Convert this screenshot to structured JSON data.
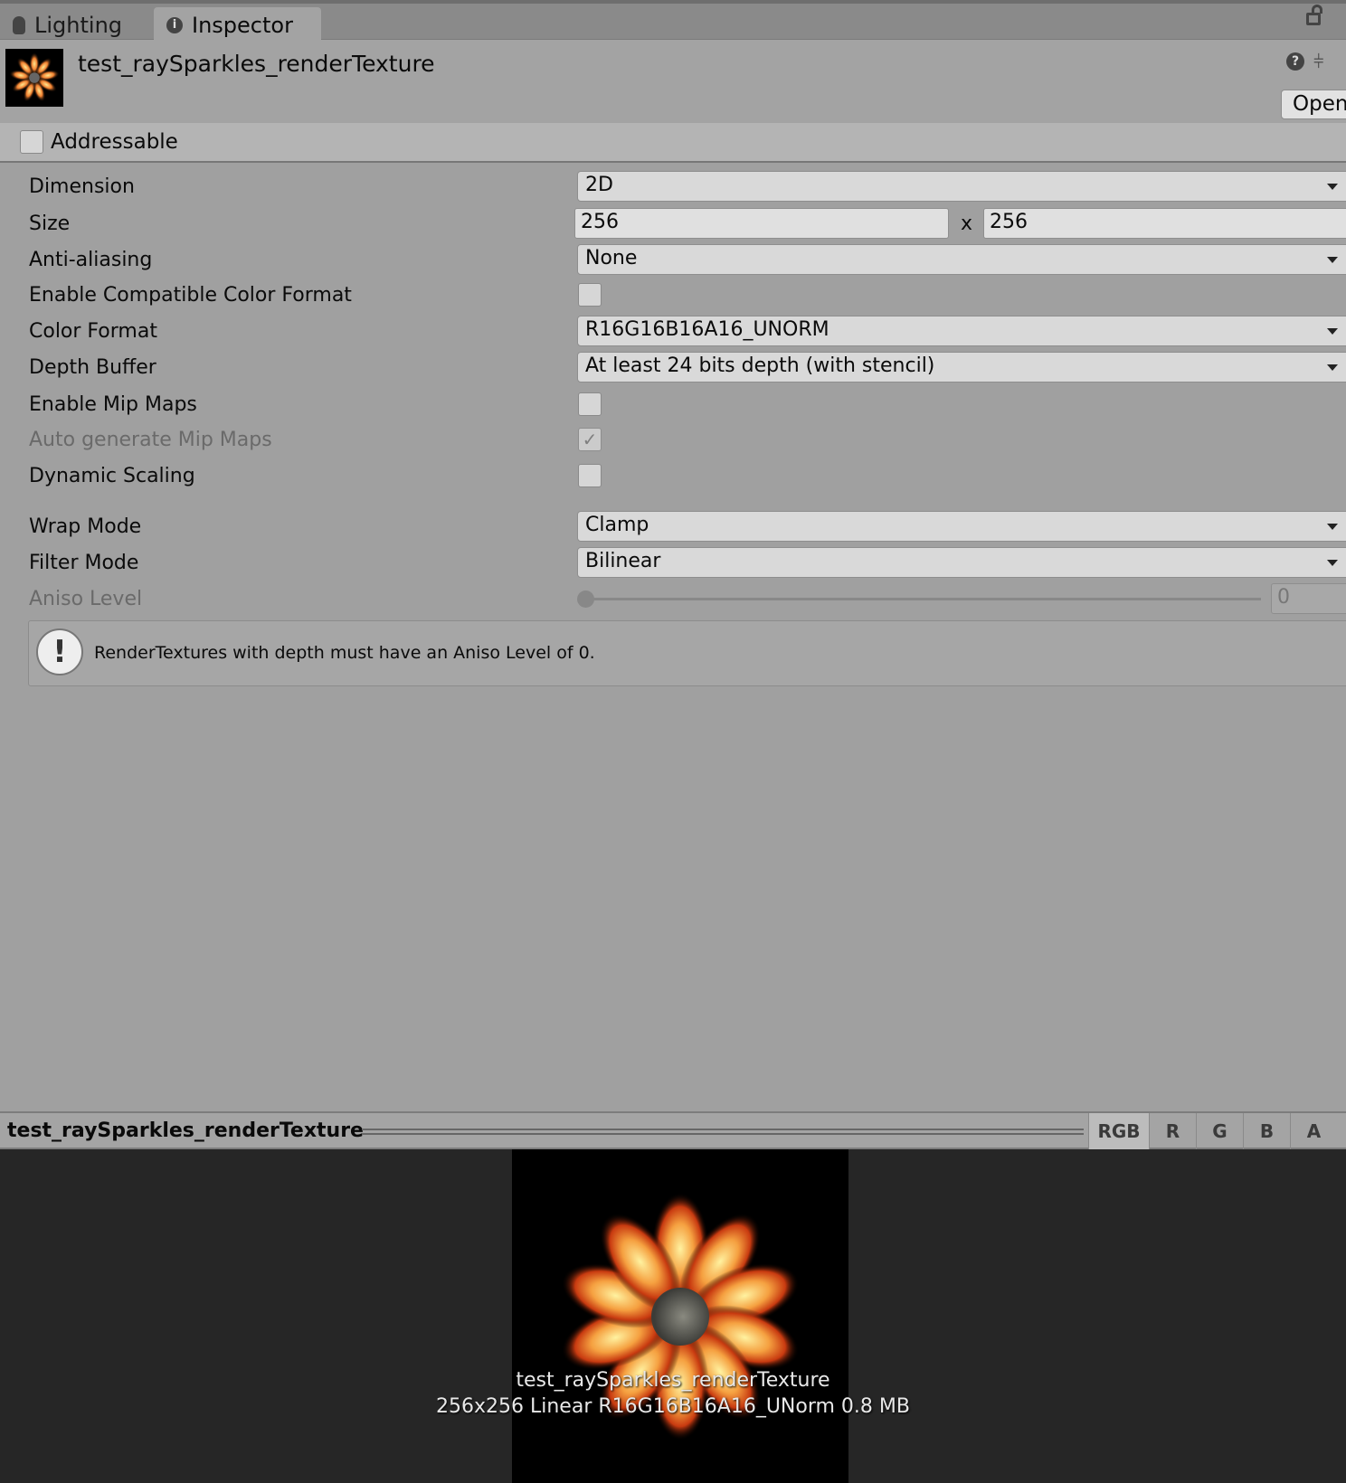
{
  "tabs": [
    {
      "label": "Lighting",
      "icon": "lightbulb-icon"
    },
    {
      "label": "Inspector",
      "icon": "info-icon"
    }
  ],
  "header": {
    "title": "test_raySparkles_renderTexture",
    "open_label": "Open"
  },
  "addressable": {
    "label": "Addressable",
    "checked": false
  },
  "fields": {
    "dimension": {
      "label": "Dimension",
      "value": "2D"
    },
    "size": {
      "label": "Size",
      "width": "256",
      "sep": "x",
      "height": "256"
    },
    "anti_aliasing": {
      "label": "Anti-aliasing",
      "value": "None"
    },
    "compat_color": {
      "label": "Enable Compatible Color Format",
      "checked": false
    },
    "color_format": {
      "label": "Color Format",
      "value": "R16G16B16A16_UNORM"
    },
    "depth_buffer": {
      "label": "Depth Buffer",
      "value": "At least 24 bits depth (with stencil)"
    },
    "mip_maps": {
      "label": "Enable Mip Maps",
      "checked": false
    },
    "auto_mip": {
      "label": "Auto generate Mip Maps",
      "checked": true
    },
    "dynamic_scaling": {
      "label": "Dynamic Scaling",
      "checked": false
    },
    "wrap_mode": {
      "label": "Wrap Mode",
      "value": "Clamp"
    },
    "filter_mode": {
      "label": "Filter Mode",
      "value": "Bilinear"
    },
    "aniso": {
      "label": "Aniso Level",
      "value": "0"
    }
  },
  "help": {
    "text": "RenderTextures with depth must have an Aniso Level of 0."
  },
  "preview": {
    "title": "test_raySparkles_renderTexture",
    "channels": [
      "RGB",
      "R",
      "G",
      "B",
      "A"
    ],
    "caption_name": "test_raySparkles_renderTexture",
    "caption_info": "256x256 Linear  R16G16B16A16_UNorm  0.8 MB"
  }
}
